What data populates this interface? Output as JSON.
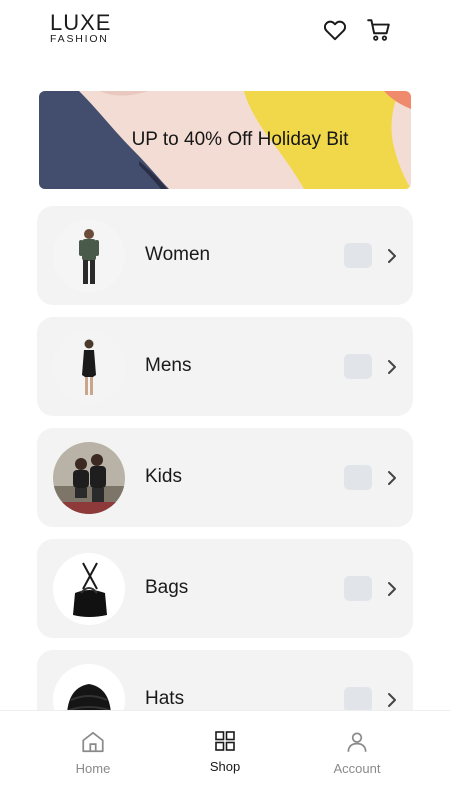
{
  "header": {
    "logo_main": "LUXE",
    "logo_sub": "FASHION",
    "icons": [
      "heart-icon",
      "cart-icon"
    ]
  },
  "banner": {
    "text": "UP to 40% Off Holiday Bit",
    "colors": {
      "background": "#f3dcd4",
      "navy": "#434d6e",
      "yellow": "#f1d84a",
      "coral": "#ef8a6c"
    }
  },
  "categories": [
    {
      "label": "Women",
      "image": "person-standing"
    },
    {
      "label": "Mens",
      "image": "woman-black-dress"
    },
    {
      "label": "Kids",
      "image": "two-kids"
    },
    {
      "label": "Bags",
      "image": "black-handbag"
    },
    {
      "label": "Hats",
      "image": "knit-beanie"
    }
  ],
  "bottom_nav": {
    "items": [
      {
        "label": "Home",
        "icon": "home-icon",
        "active": false
      },
      {
        "label": "Shop",
        "icon": "grid-icon",
        "active": true
      },
      {
        "label": "Account",
        "icon": "user-icon",
        "active": false
      }
    ]
  },
  "colors": {
    "card_bg": "#f3f3f3",
    "checkbox_bg": "#e1e5ea",
    "inactive_nav": "#8a8a8a"
  }
}
